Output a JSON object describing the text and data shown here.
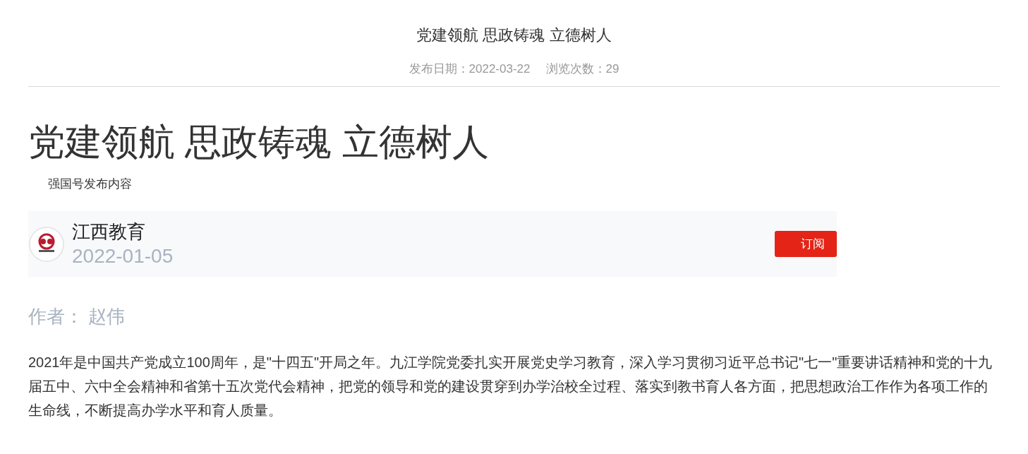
{
  "header": {
    "title": "党建领航 思政铸魂 立德树人",
    "publish_date": "发布日期：2022-03-22",
    "views": "浏览次数：29"
  },
  "article": {
    "title": "党建领航 思政铸魂 立德树人",
    "source_label": "强国号发布内容",
    "account": {
      "name": "江西教育",
      "date": "2022-01-05",
      "subscribe_button": "订阅"
    },
    "author": "作者： 赵伟",
    "paragraphs": [
      "2021年是中国共产党成立100周年，是\"十四五\"开局之年。九江学院党委扎实开展党史学习教育，深入学习贯彻习近平总书记\"七一\"重要讲话精神和党的十九届五中、六中全会精神和省第十五次党代会精神，把党的领导和党的建设贯穿到办学治校全过程、落实到教书育人各方面，把思想政治工作作为各项工作的生命线，不断提高办学水平和育人质量。"
    ]
  }
}
